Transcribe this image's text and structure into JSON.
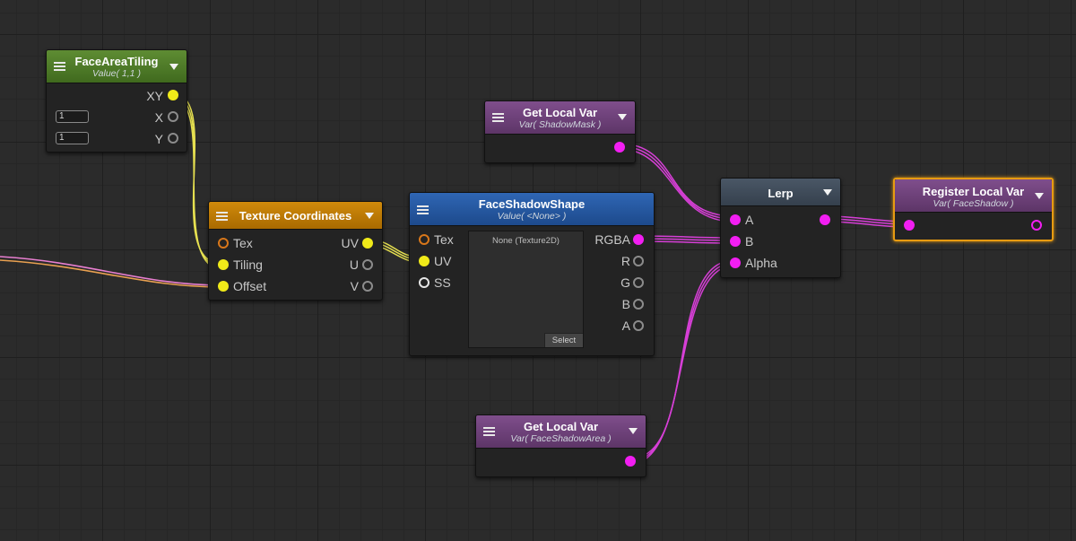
{
  "nodes": {
    "face_area_tiling": {
      "title": "FaceAreaTiling",
      "subtitle": "Value( 1,1 )",
      "out_xy": "XY",
      "in_x": "X",
      "in_y": "Y",
      "x_value": "1",
      "y_value": "1"
    },
    "texture_coordinates": {
      "title": "Texture Coordinates",
      "in_tex": "Tex",
      "in_tiling": "Tiling",
      "in_offset": "Offset",
      "out_uv": "UV",
      "out_u": "U",
      "out_v": "V"
    },
    "face_shadow_shape": {
      "title": "FaceShadowShape",
      "subtitle": "Value( <None> )",
      "in_tex": "Tex",
      "in_uv": "UV",
      "in_ss": "SS",
      "out_rgba": "RGBA",
      "out_r": "R",
      "out_g": "G",
      "out_b": "B",
      "out_a": "A",
      "preview_text": "None (Texture2D)",
      "select_label": "Select"
    },
    "get_local_var_1": {
      "title": "Get Local Var",
      "subtitle": "Var( ShadowMask )"
    },
    "get_local_var_2": {
      "title": "Get Local Var",
      "subtitle": "Var( FaceShadowArea )"
    },
    "lerp": {
      "title": "Lerp",
      "in_a": "A",
      "in_b": "B",
      "in_alpha": "Alpha"
    },
    "register_local_var": {
      "title": "Register Local Var",
      "subtitle": "Var( FaceShadow )"
    }
  },
  "colors": {
    "vector2_port": "#f0ea19",
    "color_port": "#f21ef2",
    "selection": "#e79b11",
    "texture_port": "#d8771a"
  }
}
